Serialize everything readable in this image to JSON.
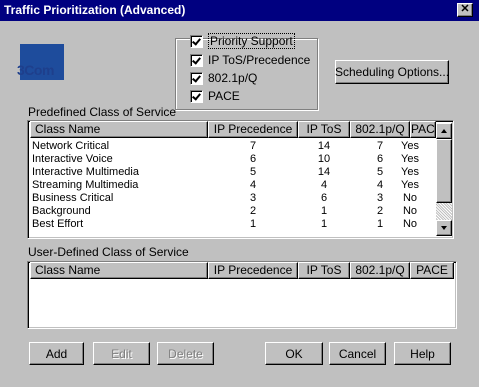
{
  "window": {
    "title": "Traffic Prioritization  (Advanced)",
    "close_glyph": "✕"
  },
  "logo": {
    "text": "3Com"
  },
  "options": [
    {
      "label": "Priority Support",
      "checked": true
    },
    {
      "label": "IP ToS/Precedence",
      "checked": true
    },
    {
      "label": "802.1p/Q",
      "checked": true
    },
    {
      "label": "PACE",
      "checked": true
    }
  ],
  "scheduling_button": "Scheduling Options...",
  "predefined": {
    "label": "Predefined Class of Service",
    "columns": [
      "Class Name",
      "IP Precedence",
      "IP ToS",
      "802.1p/Q",
      "PACE"
    ],
    "rows": [
      [
        "Network Critical",
        "7",
        "14",
        "7",
        "Yes"
      ],
      [
        "Interactive Voice",
        "6",
        "10",
        "6",
        "Yes"
      ],
      [
        "Interactive Multimedia",
        "5",
        "14",
        "5",
        "Yes"
      ],
      [
        "Streaming Multimedia",
        "4",
        "4",
        "4",
        "Yes"
      ],
      [
        "Business Critical",
        "3",
        "6",
        "3",
        "No"
      ],
      [
        "Background",
        "2",
        "1",
        "2",
        "No"
      ],
      [
        "Best Effort",
        "1",
        "1",
        "1",
        "No"
      ]
    ]
  },
  "user_defined": {
    "label": "User-Defined Class of Service",
    "columns": [
      "Class Name",
      "IP Precedence",
      "IP ToS",
      "802.1p/Q",
      "PACE"
    ],
    "rows": []
  },
  "buttons": {
    "add": "Add",
    "edit": "Edit",
    "delete": "Delete",
    "ok": "OK",
    "cancel": "Cancel",
    "help": "Help"
  },
  "colors": {
    "titlebar": "#000080",
    "face": "#c0c0c0",
    "logo": "#1e4c9c"
  }
}
